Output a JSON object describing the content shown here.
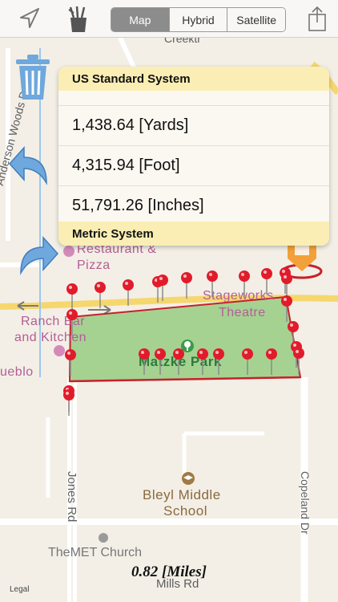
{
  "toolbar": {
    "location_icon": "location-arrow-icon",
    "tools_icon": "pen-cup-icon",
    "map_types": [
      "Map",
      "Hybrid",
      "Satellite"
    ],
    "selected_map_type": "Map",
    "share_icon": "share-icon"
  },
  "map": {
    "labels": {
      "creektr": "Creektr",
      "anderson_woods": "Anderson Woods Dr",
      "restaurant": "Restaurant &",
      "pizza": "Pizza",
      "stageworks": "Stageworks",
      "theatre": "Theatre",
      "ranch_bar": "Ranch Bar",
      "and_kitchen": "and Kitchen",
      "pueblo": "ueblo",
      "matzke_park": "Matzke Park",
      "jones_rd": "Jones Rd",
      "bleyl_middle": "Bleyl Middle",
      "school": "School",
      "copeland": "Copeland Dr",
      "met_church": "TheMET Church",
      "mills_rd": "Mills Rd"
    },
    "pin_count": 26,
    "area_fill": "#a5d291",
    "area_stroke": "#c8202a"
  },
  "side_tools": {
    "trash_icon": "trash-icon",
    "undo_icon": "undo-arrow-icon",
    "redo_icon": "redo-arrow-icon"
  },
  "measurements": {
    "us_header": "US Standard System",
    "rows": [
      "1,438.64 [Yards]",
      "4,315.94 [Foot]",
      "51,791.26 [Inches]"
    ],
    "metric_header": "Metric System"
  },
  "distance": "0.82 [Miles]",
  "legal": "Legal",
  "colors": {
    "accent_blue": "#6fa8dc",
    "pin_red": "#e21b2b",
    "panel_header": "#fbeeb4"
  }
}
